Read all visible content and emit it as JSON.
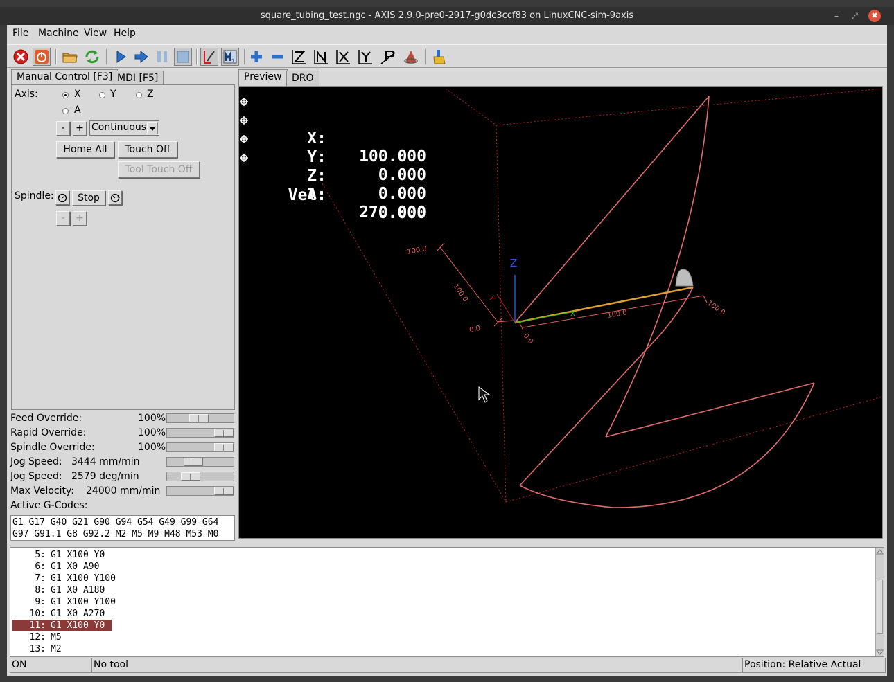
{
  "window": {
    "title": "square_tubing_test.ngc - AXIS 2.9.0-pre0-2917-g0dc3ccf83 on LinuxCNC-sim-9axis",
    "minimize": "–",
    "maximize": "⤢",
    "close": "✖"
  },
  "menu": [
    "File",
    "Machine",
    "View",
    "Help"
  ],
  "toolbar": {
    "icons": [
      "estop-icon",
      "machine-power-icon",
      "open-file-icon",
      "reload-icon",
      "run-icon",
      "step-icon",
      "pause-icon",
      "stop-icon",
      "block-delete-icon",
      "optional-stop-icon",
      "zoom-in-icon",
      "zoom-out-icon",
      "view-z-icon",
      "view-z2-icon",
      "view-x-icon",
      "view-y-icon",
      "view-p-icon",
      "rotate-icon",
      "clear-plot-icon"
    ],
    "colors": {
      "estop": "#d21e1e",
      "power": "#e05a2a",
      "run": "#2a6fc8",
      "plus": "#2a6fc8"
    }
  },
  "left_tabs": [
    "Manual Control [F3]",
    "MDI [F5]"
  ],
  "manual": {
    "axis_label": "Axis:",
    "axes": [
      {
        "label": "X",
        "selected": true
      },
      {
        "label": "Y",
        "selected": false
      },
      {
        "label": "Z",
        "selected": false
      },
      {
        "label": "A",
        "selected": false
      }
    ],
    "jog_minus": "-",
    "jog_plus": "+",
    "jog_mode": "Continuous",
    "home_all": "Home All",
    "touch_off": "Touch Off",
    "tool_touch_off": "Tool Touch Off",
    "spindle_label": "Spindle:",
    "spindle_stop": "Stop",
    "spindle_minus": "-",
    "spindle_plus": "+"
  },
  "overrides": [
    {
      "label": "Feed Override:",
      "value": "100",
      "unit": "%",
      "fraction": 0.47
    },
    {
      "label": "Rapid Override:",
      "value": "100",
      "unit": "%",
      "fraction": 1.0
    },
    {
      "label": "Spindle Override:",
      "value": "100",
      "unit": "%",
      "fraction": 1.0
    },
    {
      "label": "Jog Speed:",
      "value": "3444 mm/min",
      "unit": "",
      "fraction": 0.36
    },
    {
      "label": "Jog Speed:",
      "value": "2579 deg/min",
      "unit": "",
      "fraction": 0.3
    },
    {
      "label": "Max Velocity:",
      "value": "24000 mm/min",
      "unit": "",
      "fraction": 1.0
    }
  ],
  "active_gcodes_label": "Active G-Codes:",
  "active_gcodes": [
    "G1 G17 G40 G21 G90 G94 G54 G49 G99 G64",
    "G97 G91.1 G8 G92.2 M2 M5 M9 M48 M53 M0"
  ],
  "right_tabs": [
    "Preview",
    "DRO"
  ],
  "dro": [
    {
      "axis": "X:",
      "value": "100.000",
      "homed": true
    },
    {
      "axis": "Y:",
      "value": "0.000",
      "homed": true
    },
    {
      "axis": "Z:",
      "value": "0.000",
      "homed": true
    },
    {
      "axis": "A:",
      "value": "270.000",
      "homed": true
    },
    {
      "axis": "Vel:",
      "value": "0.000",
      "homed": false
    }
  ],
  "preview_labels": {
    "z_axis": "Z",
    "y_axis": "Y",
    "x_axis": "X",
    "dim_y_top": "100.0",
    "dim_y_mid": "100.0",
    "dim_y_zero": "0.0",
    "dim_x_mid": "100.0",
    "dim_x_end": "100.0",
    "dim_x_zero": "0.0"
  },
  "gcode_lines": [
    {
      "num": "5:",
      "code": "G1 X100 Y0",
      "current": false
    },
    {
      "num": "6:",
      "code": "G1 X0 A90",
      "current": false
    },
    {
      "num": "7:",
      "code": "G1 X100 Y100",
      "current": false
    },
    {
      "num": "8:",
      "code": "G1 X0 A180",
      "current": false
    },
    {
      "num": "9:",
      "code": "G1 X100 Y100",
      "current": false
    },
    {
      "num": "10:",
      "code": "G1 X0 A270",
      "current": false
    },
    {
      "num": "11:",
      "code": "G1 X100 Y0",
      "current": true
    },
    {
      "num": "12:",
      "code": "M5",
      "current": false
    },
    {
      "num": "13:",
      "code": "M2",
      "current": false
    }
  ],
  "status": {
    "machine": "ON",
    "tool": "No tool",
    "position": "Position: Relative Actual"
  }
}
